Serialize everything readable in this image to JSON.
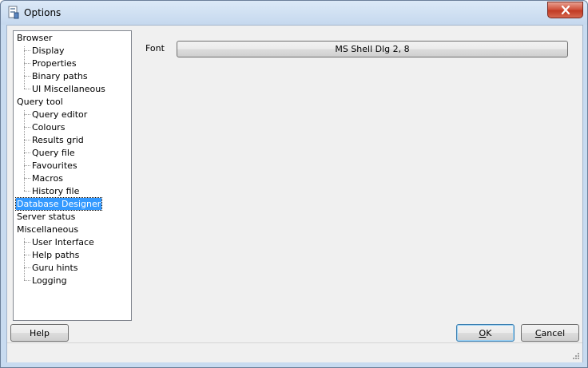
{
  "window": {
    "title": "Options"
  },
  "tree": {
    "items": [
      {
        "label": "Browser",
        "level": 0,
        "selected": false
      },
      {
        "label": "Display",
        "level": 1,
        "selected": false
      },
      {
        "label": "Properties",
        "level": 1,
        "selected": false
      },
      {
        "label": "Binary paths",
        "level": 1,
        "selected": false
      },
      {
        "label": "UI Miscellaneous",
        "level": 1,
        "selected": false
      },
      {
        "label": "Query tool",
        "level": 0,
        "selected": false
      },
      {
        "label": "Query editor",
        "level": 1,
        "selected": false
      },
      {
        "label": "Colours",
        "level": 1,
        "selected": false
      },
      {
        "label": "Results grid",
        "level": 1,
        "selected": false
      },
      {
        "label": "Query file",
        "level": 1,
        "selected": false
      },
      {
        "label": "Favourites",
        "level": 1,
        "selected": false
      },
      {
        "label": "Macros",
        "level": 1,
        "selected": false
      },
      {
        "label": "History file",
        "level": 1,
        "selected": false
      },
      {
        "label": "Database Designer",
        "level": 0,
        "selected": true
      },
      {
        "label": "Server status",
        "level": 0,
        "selected": false
      },
      {
        "label": "Miscellaneous",
        "level": 0,
        "selected": false
      },
      {
        "label": "User Interface",
        "level": 1,
        "selected": false
      },
      {
        "label": "Help paths",
        "level": 1,
        "selected": false
      },
      {
        "label": "Guru hints",
        "level": 1,
        "selected": false
      },
      {
        "label": "Logging",
        "level": 1,
        "selected": false
      }
    ]
  },
  "font_setting": {
    "label": "Font",
    "value": "MS Shell Dlg 2, 8"
  },
  "buttons": {
    "help": "Help",
    "ok_prefix": "O",
    "ok_rest": "K",
    "cancel_prefix": "C",
    "cancel_rest": "ancel"
  },
  "icons": {
    "app": "options-app-icon",
    "close": "close-icon",
    "grip": "resize-grip-icon"
  },
  "colors": {
    "selection": "#3399ff",
    "close_button": "#c13a24"
  }
}
